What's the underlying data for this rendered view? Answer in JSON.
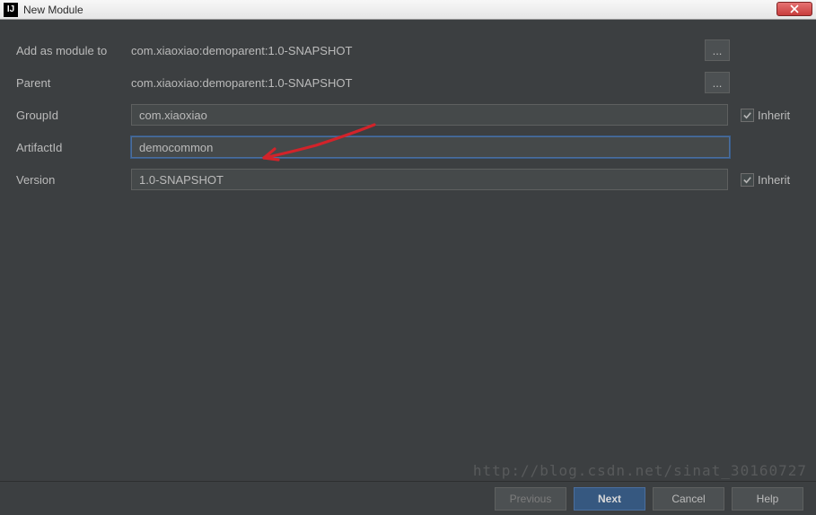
{
  "window": {
    "title": "New Module",
    "app_icon_text": "IJ"
  },
  "form": {
    "addAsModule": {
      "label": "Add as module to",
      "value": "com.xiaoxiao:demoparent:1.0-SNAPSHOT"
    },
    "parent": {
      "label": "Parent",
      "value": "com.xiaoxiao:demoparent:1.0-SNAPSHOT"
    },
    "groupId": {
      "label": "GroupId",
      "value": "com.xiaoxiao",
      "inherit_label": "Inherit",
      "inherit_checked": true
    },
    "artifactId": {
      "label": "ArtifactId",
      "value": "democommon"
    },
    "version": {
      "label": "Version",
      "value": "1.0-SNAPSHOT",
      "inherit_label": "Inherit",
      "inherit_checked": true
    }
  },
  "buttons": {
    "previous": "Previous",
    "next": "Next",
    "cancel": "Cancel",
    "help": "Help"
  },
  "ellipsis": "...",
  "watermark": "http://blog.csdn.net/sinat_30160727"
}
